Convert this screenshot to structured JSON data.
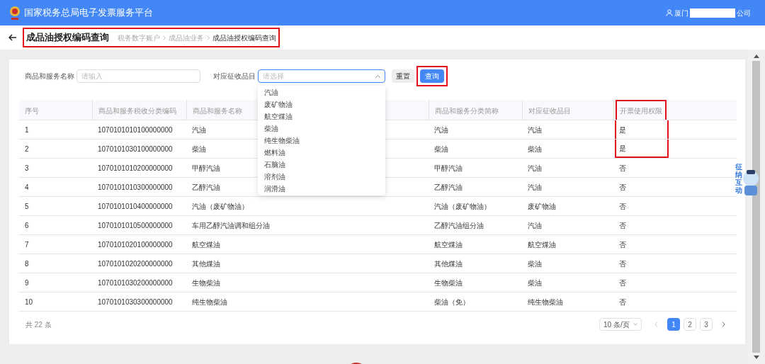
{
  "header": {
    "title": "国家税务总局电子发票服务平台",
    "user_prefix": "厦门",
    "user_suffix": "公司"
  },
  "page": {
    "title": "成品油授权编码查询",
    "highlighted": true,
    "breadcrumb": [
      {
        "label": "税务数字账户",
        "current": false
      },
      {
        "label": "成品油业务",
        "current": false
      },
      {
        "label": "成品油授权编码查询",
        "current": true
      }
    ]
  },
  "filters": {
    "name_label": "商品和服务名称",
    "name_placeholder": "请输入",
    "category_label": "对应征收品目",
    "category_placeholder": "请选择",
    "expanded": true,
    "options": [
      "汽油",
      "废矿物油",
      "航空煤油",
      "柴油",
      "纯生物柴油",
      "燃料油",
      "石脑油",
      "溶剂油",
      "润滑油"
    ],
    "reset": "重置",
    "search": "查询",
    "search_highlighted": true
  },
  "table": {
    "columns": [
      {
        "label": "序号",
        "highlighted": false
      },
      {
        "label": "商品和服务税收分类编码",
        "highlighted": false
      },
      {
        "label": "商品和服务名称",
        "highlighted": false
      },
      {
        "label": "商品和服务分类简称",
        "highlighted": false
      },
      {
        "label": "对应征收品目",
        "highlighted": false
      },
      {
        "label": "开票使用权限",
        "highlighted": true
      }
    ],
    "rows": [
      {
        "cells": [
          "1",
          "1070101010100000000",
          "汽油",
          "汽油",
          "汽油",
          "是"
        ],
        "highlighted": true
      },
      {
        "cells": [
          "2",
          "1070101030100000000",
          "柴油",
          "柴油",
          "柴油",
          "是"
        ],
        "highlighted": true
      },
      {
        "cells": [
          "3",
          "1070101010200000000",
          "甲醇汽油",
          "甲醇汽油",
          "汽油",
          "否"
        ],
        "highlighted": false
      },
      {
        "cells": [
          "4",
          "1070101010300000000",
          "乙醇汽油",
          "乙醇汽油",
          "汽油",
          "否"
        ],
        "highlighted": false
      },
      {
        "cells": [
          "5",
          "1070101010400000000",
          "汽油（废矿物油）",
          "汽油（废矿物油）",
          "废矿物油",
          "否"
        ],
        "highlighted": false
      },
      {
        "cells": [
          "6",
          "1070101010500000000",
          "车用乙醇汽油调和组分油",
          "乙醇汽油组分油",
          "汽油",
          "否"
        ],
        "highlighted": false
      },
      {
        "cells": [
          "7",
          "1070101020100000000",
          "航空煤油",
          "航空煤油",
          "航空煤油",
          "否"
        ],
        "highlighted": false
      },
      {
        "cells": [
          "8",
          "1070101020200000000",
          "其他煤油",
          "其他煤油",
          "柴油",
          "否"
        ],
        "highlighted": false
      },
      {
        "cells": [
          "9",
          "1070101030200000000",
          "生物柴油",
          "生物柴油",
          "柴油",
          "否"
        ],
        "highlighted": false
      },
      {
        "cells": [
          "10",
          "1070101030300000000",
          "纯生物柴油",
          "柴油（免）",
          "纯生物柴油",
          "否"
        ],
        "highlighted": false
      }
    ]
  },
  "footer": {
    "total": "共 22 条",
    "page_size": "10 条/页",
    "pages": [
      {
        "label": "1",
        "selected": true
      },
      {
        "label": "2",
        "selected": false
      },
      {
        "label": "3",
        "selected": false
      }
    ]
  },
  "widget": {
    "chars": [
      "征",
      "纳",
      "互",
      "动"
    ]
  }
}
